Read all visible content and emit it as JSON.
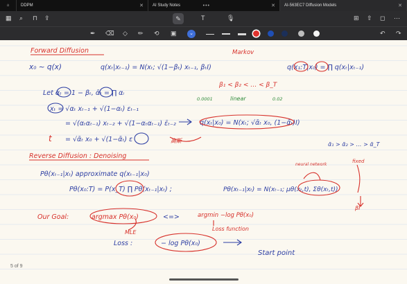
{
  "tabs": [
    {
      "label": "DDPM"
    },
    {
      "label": "AI Study Notes"
    },
    {
      "label": "AI-563EC7 Diffusion Models"
    }
  ],
  "page_indicator": "5 of 9",
  "colors": {
    "red_swatch": "#e0322e",
    "blue_swatch": "#1f4fb5",
    "dark_swatch": "#1b2f59",
    "gray_swatch": "#bdbdbd",
    "white_swatch": "#f4f4f4",
    "ink_blue": "#2d3ea3",
    "ink_red": "#d7302a"
  },
  "notes": {
    "forward_title": "Forward Diffusion",
    "markov": "Markov",
    "x0_dist": "x₀ ~ q(x)",
    "q_step": "q(xₜ|xₜ₋₁) = N(xₜ; √(1−βₜ) xₜ₋₁, βₜI)",
    "q_joint": "q(x₁:T|x₀) = ∏ q(xₜ|xₜ₋₁)",
    "beta_order": "β₁ < β₂ < … < β_T",
    "beta_start": "0.0001",
    "linear": "linear",
    "beta_end": "0.02",
    "let_alpha": "Let αₜ = 1 − βₜ, ᾱₜ = ∏ αᵢ",
    "xt_eq": "xₜ = √αₜ xₜ₋₁ + √(1−αₜ) εₜ₋₁",
    "xt_eq2": "= √(αₜαₜ₋₁) xₜ₋₂ + √(1−αₜαₜ₋₁) ε̄ₜ₋₂",
    "xt_eq3": "= √ᾱₜ x₀ + √(1−ᾱₜ) ε",
    "q_closed": "q(xₜ|x₀) = N(xₜ; √ᾱₜ x₀, (1−ᾱₜ)I)",
    "noise_label": "高斯",
    "alpha_order": "ᾱ₁ > ᾱ₂ > … > ᾱ_T",
    "t_label": "t",
    "reverse_title": "Reverse Diffusion : Denoising",
    "p_approx": "Pθ(xₜ₋₁|xₜ)  approximate  q(xₜ₋₁|x₀)",
    "p_joint": "Pθ(x₀:T) = P(x_T) ∏ Pθ(xₜ₋₁|xₜ) ;",
    "p_step": "Pθ(xₜ₋₁|xₜ) = N(xₜ₋₁; μθ(xₜ,t), Σθ(xₜ,t))",
    "neural_network": "neural network",
    "fixed": "fixed",
    "beta_i": "βI",
    "goal_label": "Our Goal:",
    "argmax": "argmax Pθ(x₀)",
    "arrow": "<=>",
    "argmin": "argmin −log Pθ(x₀)",
    "mle": "MLE",
    "loss_fn": "Loss function",
    "loss_label": "Loss :",
    "loss_expr": "− log Pθ(x₀)",
    "start_point": "Start point"
  }
}
